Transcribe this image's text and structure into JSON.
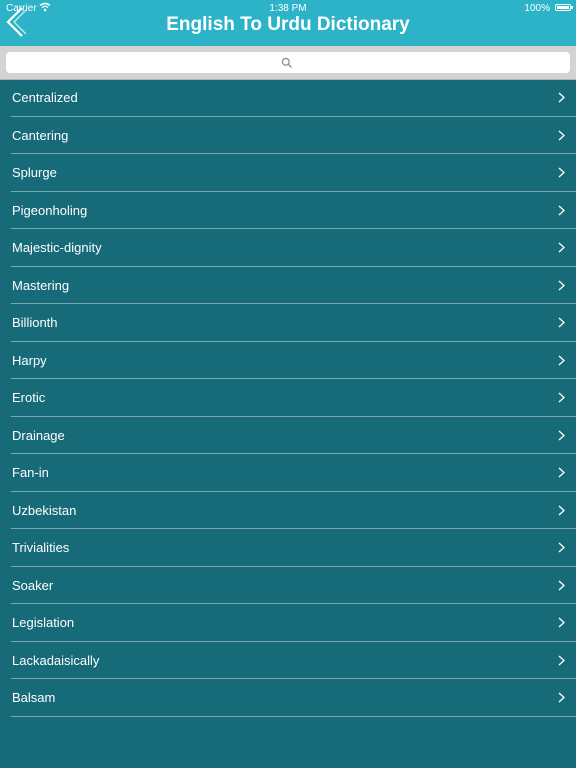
{
  "status_bar": {
    "carrier": "Carrier",
    "time": "1:38 PM",
    "battery": "100%"
  },
  "nav": {
    "title": "English To Urdu Dictionary"
  },
  "search": {
    "placeholder": ""
  },
  "words": [
    "Centralized",
    "Cantering",
    "Splurge",
    "Pigeonholing",
    "Majestic-dignity",
    "Mastering",
    "Billionth",
    "Harpy",
    "Erotic",
    "Drainage",
    "Fan-in",
    "Uzbekistan",
    "Trivialities",
    "Soaker",
    "Legislation",
    "Lackadaisically",
    "Balsam"
  ],
  "colors": {
    "header": "#2db3c8",
    "list_background": "#176a78",
    "search_bar": "#d3d3d3"
  },
  "icons": {
    "back": "chevron-left-icon",
    "search": "search-icon",
    "row": "chevron-right-icon",
    "wifi": "wifi-icon",
    "battery": "battery-icon"
  }
}
